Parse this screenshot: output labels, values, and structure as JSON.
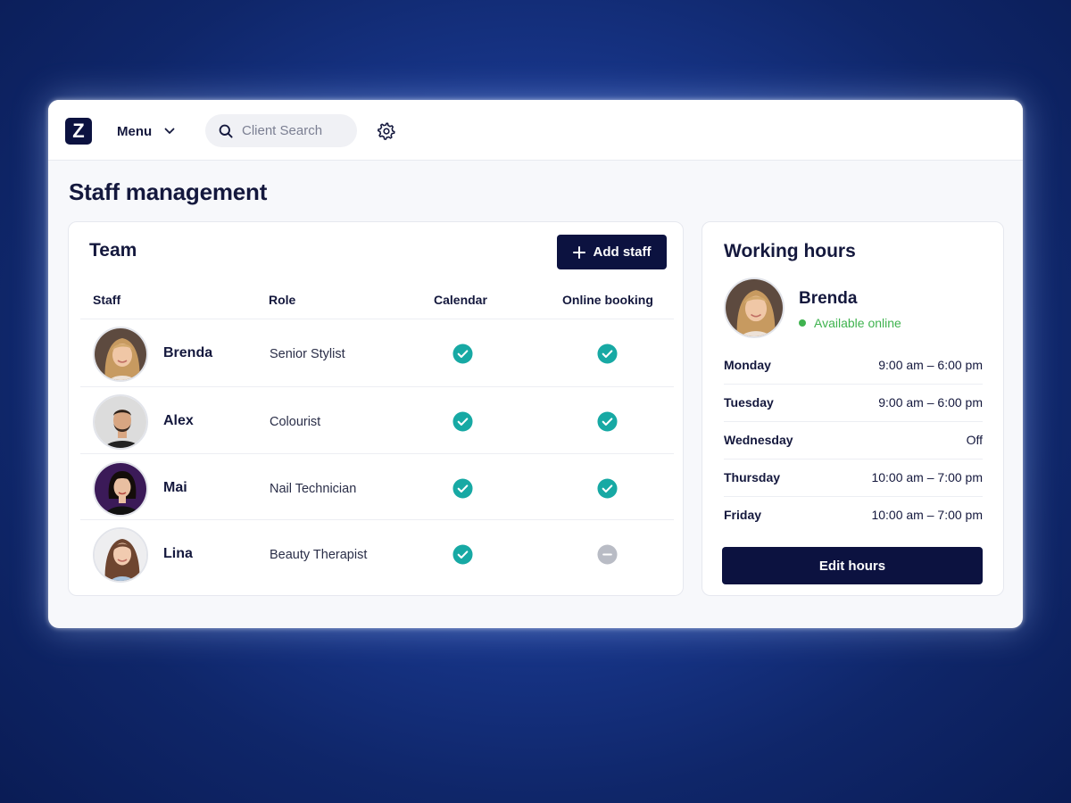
{
  "app": {
    "logo_letter": "Z",
    "menu_label": "Menu",
    "search_placeholder": "Client Search",
    "page_title": "Staff management"
  },
  "colors": {
    "brand_navy": "#0c1240",
    "check_teal": "#17a9a4",
    "disabled_gray": "#b9bcc5",
    "available_green": "#3fb34f"
  },
  "icons": [
    "chevron-down-icon",
    "search-icon",
    "gear-icon",
    "plus-icon",
    "check-circle-icon",
    "minus-circle-icon"
  ],
  "team": {
    "title": "Team",
    "add_button_label": "Add staff",
    "columns": [
      "Staff",
      "Role",
      "Calendar",
      "Online booking"
    ],
    "rows": [
      {
        "name": "Brenda",
        "role": "Senior Stylist",
        "calendar": true,
        "online_booking": true
      },
      {
        "name": "Alex",
        "role": "Colourist",
        "calendar": true,
        "online_booking": true
      },
      {
        "name": "Mai",
        "role": "Nail Technician",
        "calendar": true,
        "online_booking": true
      },
      {
        "name": "Lina",
        "role": "Beauty Therapist",
        "calendar": true,
        "online_booking": false
      }
    ]
  },
  "working_hours": {
    "title": "Working hours",
    "staff_name": "Brenda",
    "status": "Available online",
    "schedule": [
      {
        "day": "Monday",
        "hours": "9:00 am – 6:00 pm"
      },
      {
        "day": "Tuesday",
        "hours": "9:00 am – 6:00 pm"
      },
      {
        "day": "Wednesday",
        "hours": "Off"
      },
      {
        "day": "Thursday",
        "hours": "10:00 am – 7:00 pm"
      },
      {
        "day": "Friday",
        "hours": "10:00 am – 7:00 pm"
      }
    ],
    "edit_button_label": "Edit hours"
  }
}
